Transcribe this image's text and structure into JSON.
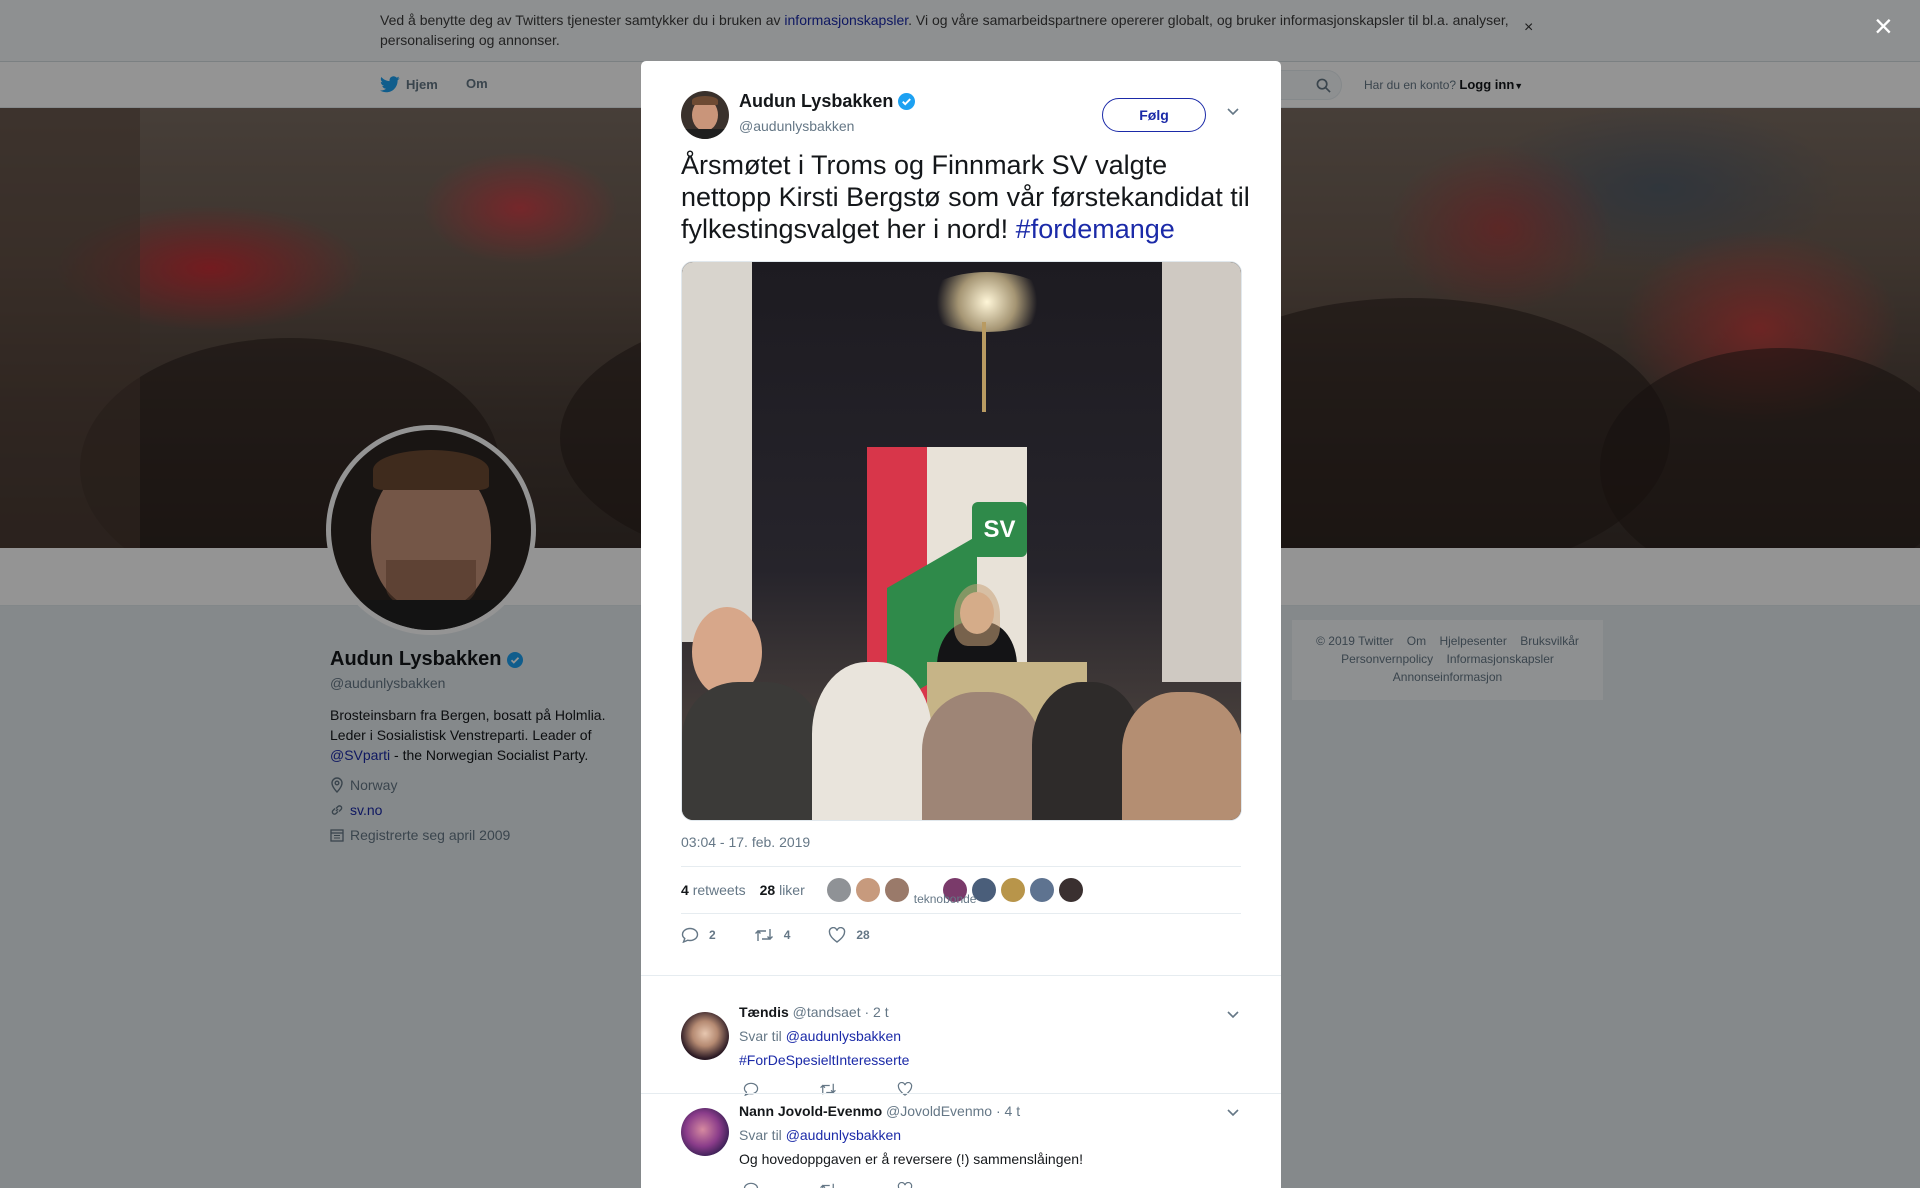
{
  "cookie": {
    "text_before": "Ved å benytte deg av Twitters tjenester samtykker du i bruken av ",
    "link": "informasjonskapsler",
    "text_after": ". Vi og våre samarbeidspartnere opererer globalt, og bruker informasjonskapsler til bl.a. analyser, personalisering og annonser.",
    "close": "×"
  },
  "nav": {
    "home": "Hjem",
    "about": "Om",
    "have_account": "Har du en konto?",
    "login": "Logg inn"
  },
  "profile": {
    "name": "Audun Lysbakken",
    "handle": "@audunlysbakken",
    "bio_line1": "Brosteinsbarn fra Bergen, bosatt på Holmlia.",
    "bio_line2": "Leder i Sosialistisk Venstreparti. Leader of",
    "bio_mention": "@SVparti",
    "bio_line3": " - the Norwegian Socialist Party.",
    "location": "Norway",
    "website": "sv.no",
    "joined": "Registrerte seg april 2009"
  },
  "footer": {
    "copyright": "© 2019 Twitter",
    "about": "Om",
    "help": "Hjelpesenter",
    "terms": "Bruksvilkår",
    "privacy": "Personvernpolicy",
    "cookies": "Informasjonskapsler",
    "ads": "Annonseinformasjon"
  },
  "overlay": {
    "close": "×"
  },
  "tweet": {
    "name": "Audun Lysbakken",
    "handle": "@audunlysbakken",
    "follow": "Følg",
    "text": "Årsmøtet i Troms og Finnmark SV valgte nettopp Kirsti Bergstø som vår førstekandidat til fylkestingsvalget her i nord! ",
    "hashtag": "#fordemange",
    "time": "03:04 - 17. feb. 2019",
    "retweets": "4",
    "retweets_label": "retweets",
    "likes": "28",
    "likes_label": "liker",
    "broken_liker_alt": "teknobonde",
    "reply_count": "2",
    "retweet_count": "4",
    "like_count": "28"
  },
  "replies": [
    {
      "name": "Tændis",
      "handle": "@tandsaet",
      "age": "· 2 t",
      "reply_to_label": "Svar til ",
      "reply_to": "@audunlysbakken",
      "body": "#ForDeSpesieltInteresserte"
    },
    {
      "name": "Nann Jovold-Evenmo",
      "handle": "@JovoldEvenmo",
      "age": "· 4 t",
      "reply_to_label": "Svar til ",
      "reply_to": "@audunlysbakken",
      "body": "Og hovedoppgaven er å reversere (!) sammenslåingen!"
    }
  ],
  "colors": {
    "link": "#1b2aa8",
    "verified": "#1da1f2",
    "muted": "#657786"
  },
  "icons": [
    "twitter-bird-icon",
    "search-icon",
    "verified-badge-icon",
    "location-icon",
    "link-icon",
    "calendar-icon",
    "reply-icon",
    "retweet-icon",
    "like-icon",
    "chevron-down-icon",
    "close-icon"
  ]
}
